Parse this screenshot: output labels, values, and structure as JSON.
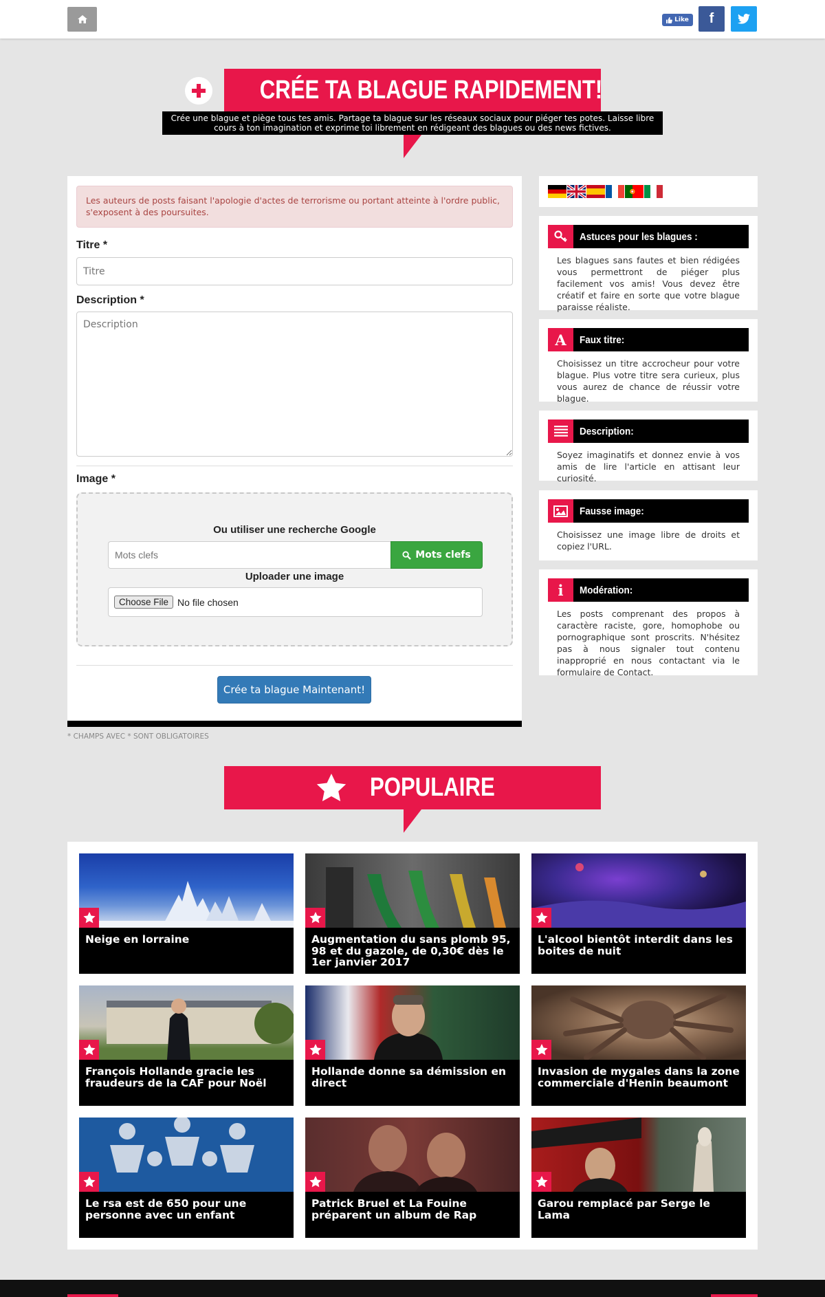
{
  "header": {
    "home_icon": "home-icon",
    "like_label": "Like",
    "facebook_icon": "facebook-icon",
    "twitter_icon": "twitter-icon"
  },
  "hero": {
    "title": "CRÉE TA BLAGUE RAPIDEMENT!",
    "subtitle": "Crée une blague et piège tous tes amis. Partage ta blague sur les réseaux sociaux pour piéger tes potes. Laisse libre cours à ton imagination et exprime toi librement en rédigeant des blagues ou des news fictives."
  },
  "form": {
    "alert": "Les auteurs de posts faisant l'apologie d'actes de terrorisme ou portant atteinte à l'ordre public, s'exposent à des poursuites.",
    "title_label": "Titre *",
    "title_placeholder": "Titre",
    "description_label": "Description *",
    "description_placeholder": "Description",
    "image_label": "Image *",
    "google_label": "Ou utiliser une recherche Google",
    "keywords_placeholder": "Mots clefs",
    "keywords_button": "Mots clefs",
    "upload_label": "Uploader une image",
    "choose_file": "Choose File",
    "no_file": "No file chosen",
    "submit": "Crée ta blague Maintenant!",
    "required_note": "* Champs avec * sont obligatoires"
  },
  "sidebar": {
    "flags": [
      "de",
      "gb",
      "es",
      "fr",
      "pt",
      "it"
    ],
    "tips": [
      {
        "icon": "key-icon",
        "title": "Astuces pour les blagues :",
        "text": "Les blagues sans fautes et bien rédigées vous permettront de piéger plus facilement vos amis! Vous devez être créatif et faire en sorte que votre blague paraisse réaliste."
      },
      {
        "icon": "font-icon",
        "title": "Faux titre:",
        "text": "Choisissez un titre accrocheur pour votre blague. Plus votre titre sera curieux, plus vous aurez de chance de réussir votre blague."
      },
      {
        "icon": "align-justify-icon",
        "title": "Description:",
        "text": "Soyez imaginatifs et donnez envie à vos amis de lire l'article en attisant leur curiosité."
      },
      {
        "icon": "picture-icon",
        "title": "Fausse image:",
        "text": "Choisissez une image libre de droits et copiez l'URL."
      },
      {
        "icon": "info-icon",
        "title": "Modération:",
        "text": "Les posts comprenant des propos à caractère raciste, gore, homophobe ou pornographique sont proscrits. N'hésitez pas à nous signaler tout contenu inapproprié en nous contactant via le formulaire de Contact."
      }
    ]
  },
  "popular": {
    "title": "POPULAIRE",
    "items": [
      {
        "title": "Neige en lorraine"
      },
      {
        "title": "Augmentation du sans plomb 95, 98 et du gazole, de 0,30€ dès le 1er janvier 2017"
      },
      {
        "title": "L'alcool bientôt interdit dans les boites de nuit"
      },
      {
        "title": "François Hollande gracie les fraudeurs de la CAF pour Noël"
      },
      {
        "title": "Hollande donne sa démission en direct"
      },
      {
        "title": "Invasion de mygales dans la zone commerciale d'Henin beaumont"
      },
      {
        "title": "Le rsa est de 650 pour une personne avec un enfant"
      },
      {
        "title": "Patrick Bruel et La Fouine préparent un album de Rap"
      },
      {
        "title": "Garou remplacé par Serge le Lama"
      }
    ]
  },
  "colors": {
    "accent": "#e8174a",
    "primary_button": "#337ab7",
    "success_button": "#3aa640"
  }
}
